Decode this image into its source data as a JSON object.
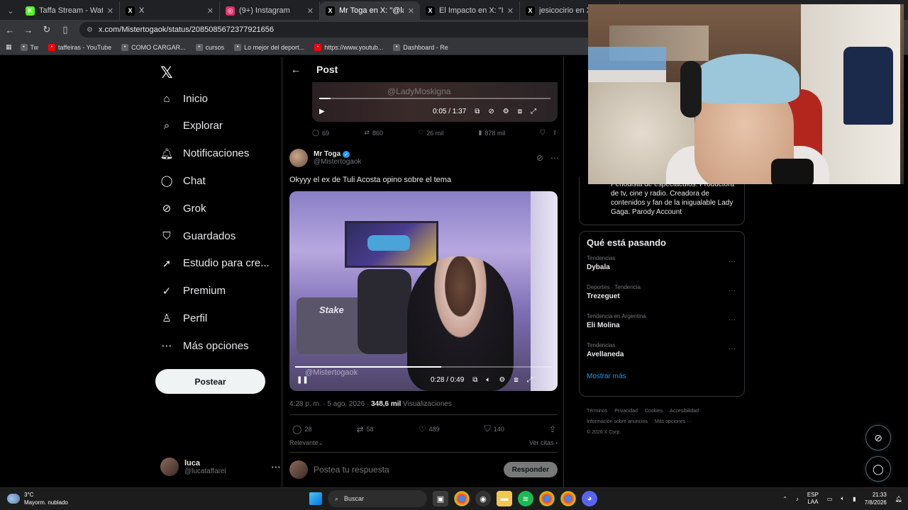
{
  "browser": {
    "tabs": [
      {
        "title": "Taffa Stream - Watch L",
        "fav": "K",
        "color": "#53fc18"
      },
      {
        "title": "X",
        "fav": "X",
        "color": "#000000"
      },
      {
        "title": "(9+) Instagram",
        "fav": "◎",
        "color": "#e1306c"
      },
      {
        "title": "Mr Toga en X: \"@ladyn",
        "fav": "X",
        "color": "#000000",
        "active": true
      },
      {
        "title": "El Impacto en X: \"INVI",
        "fav": "X",
        "color": "#000000"
      },
      {
        "title": "jesicocirio en X: \"Mas",
        "fav": "X",
        "color": "#000000"
      }
    ],
    "url": "x.com/Mistertogaok/status/2085085672377921656",
    "bookmarks": [
      "Tw",
      "taffeiras - YouTube",
      "COMO CARGAR...",
      "cursos",
      "Lo mejor del deport...",
      "https://www.youtub...",
      "Dashboard - Re"
    ]
  },
  "nav": {
    "items": [
      {
        "label": "Inicio",
        "icon": "home-icon",
        "glyph": "⌂"
      },
      {
        "label": "Explorar",
        "icon": "search-icon",
        "glyph": "⌕"
      },
      {
        "label": "Notificaciones",
        "icon": "bell-icon",
        "glyph": "🔔︎"
      },
      {
        "label": "Chat",
        "icon": "chat-icon",
        "glyph": "◯"
      },
      {
        "label": "Grok",
        "icon": "grok-icon",
        "glyph": "⊘"
      },
      {
        "label": "Guardados",
        "icon": "bookmark-icon",
        "glyph": "⛉"
      },
      {
        "label": "Estudio para cre...",
        "icon": "rocket-icon",
        "glyph": "➚"
      },
      {
        "label": "Premium",
        "icon": "premium-icon",
        "glyph": "✓"
      },
      {
        "label": "Perfil",
        "icon": "profile-icon",
        "glyph": "♙"
      },
      {
        "label": "Más opciones",
        "icon": "more-options-icon",
        "glyph": "⋯"
      }
    ],
    "post_label": "Postear",
    "account": {
      "name": "luca",
      "handle": "@lucataffarel"
    }
  },
  "main": {
    "header_title": "Post",
    "quoted_video": {
      "watermark": "@LadyMoskigna",
      "time": "0:05 / 1:37",
      "progress": 0.05
    },
    "quoted_actions": {
      "replies": "69",
      "reposts": "860",
      "likes": "26 mil",
      "views": "878 mil"
    },
    "tweet": {
      "author": "Mr Toga",
      "handle": "@Mistertogaok",
      "text": "Okyyy el ex de Tuli Acosta opino sobre el tema",
      "video_watermark": "@Mistertogaok",
      "video_brand": "Stake",
      "video_time": "0:28 / 0:49",
      "video_progress": 0.57,
      "timestamp": "4:28 p. m. · 5 ago. 2026 · ",
      "views": "348,6 mil",
      "views_label": " Visualizaciones",
      "replies": "28",
      "reposts": "58",
      "likes": "489",
      "bookmarks": "140"
    },
    "relevant": "Relevante",
    "quotes_link": "Ver citas",
    "reply_placeholder": "Postea tu respuesta",
    "reply_button": "Responder"
  },
  "right": {
    "bio": "Periodista de espectáculos. Productora de tv, cine y radio. Creadora de contenidos y fan de la inigualable Lady Gaga. Parody Account",
    "trends_title": "Qué está pasando",
    "trends": [
      {
        "category": "Tendencias",
        "name": "Dybala"
      },
      {
        "category": "Deportes · Tendencia",
        "name": "Trezeguet"
      },
      {
        "category": "Tendencia en Argentina",
        "name": "Eli Molina"
      },
      {
        "category": "Tendencias",
        "name": "Avellaneda"
      }
    ],
    "show_more": "Mostrar más",
    "footer": [
      "Términos",
      "Privacidad",
      "Cookies",
      "Accesibilidad",
      "Información sobre anuncios",
      "Más opciones ···",
      "© 2026 X Corp."
    ]
  },
  "taskbar": {
    "temp": "3°C",
    "weather": "Mayorm. nublado",
    "search": "Buscar",
    "lang1": "ESP",
    "lang2": "LAA",
    "time": "21:33",
    "date": "7/8/2026"
  }
}
